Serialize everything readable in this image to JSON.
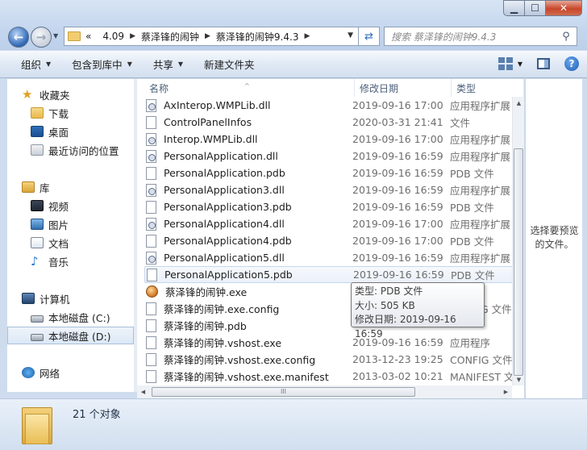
{
  "window": {
    "min_glyph": "▁",
    "max_glyph": "☐",
    "close_glyph": "✕"
  },
  "address": {
    "overflow": "«",
    "crumbs": [
      "4.09",
      "蔡泽锋的闹钟",
      "蔡泽锋的闹钟9.4.3"
    ],
    "separator": "▶",
    "dropdown": "▼"
  },
  "search": {
    "placeholder": "搜索 蔡泽锋的闹钟9.4.3"
  },
  "toolbar": {
    "organize": "组织",
    "include_in_library": "包含到库中",
    "share": "共享",
    "new_folder": "新建文件夹",
    "help": "?"
  },
  "nav": {
    "favorites": "收藏夹",
    "downloads": "下载",
    "desktop": "桌面",
    "recent": "最近访问的位置",
    "libraries": "库",
    "videos": "视频",
    "pictures": "图片",
    "documents": "文档",
    "music": "音乐",
    "computer": "计算机",
    "drive_c": "本地磁盘 (C:)",
    "drive_d": "本地磁盘 (D:)",
    "network": "网络"
  },
  "columns": {
    "name": "名称",
    "date": "修改日期",
    "type": "类型"
  },
  "files": [
    {
      "name": "AxInterop.WMPLib.dll",
      "date": "2019-09-16 17:00",
      "type": "应用程序扩展",
      "icon": "dll-icon"
    },
    {
      "name": "ControlPanelInfos",
      "date": "2020-03-31 21:41",
      "type": "文件",
      "icon": "file-icon"
    },
    {
      "name": "Interop.WMPLib.dll",
      "date": "2019-09-16 17:00",
      "type": "应用程序扩展",
      "icon": "dll-icon"
    },
    {
      "name": "PersonalApplication.dll",
      "date": "2019-09-16 16:59",
      "type": "应用程序扩展",
      "icon": "dll-icon"
    },
    {
      "name": "PersonalApplication.pdb",
      "date": "2019-09-16 16:59",
      "type": "PDB 文件",
      "icon": "file-icon"
    },
    {
      "name": "PersonalApplication3.dll",
      "date": "2019-09-16 16:59",
      "type": "应用程序扩展",
      "icon": "dll-icon"
    },
    {
      "name": "PersonalApplication3.pdb",
      "date": "2019-09-16 16:59",
      "type": "PDB 文件",
      "icon": "file-icon"
    },
    {
      "name": "PersonalApplication4.dll",
      "date": "2019-09-16 17:00",
      "type": "应用程序扩展",
      "icon": "dll-icon"
    },
    {
      "name": "PersonalApplication4.pdb",
      "date": "2019-09-16 17:00",
      "type": "PDB 文件",
      "icon": "file-icon"
    },
    {
      "name": "PersonalApplication5.dll",
      "date": "2019-09-16 16:59",
      "type": "应用程序扩展",
      "icon": "dll-icon"
    },
    {
      "name": "PersonalApplication5.pdb",
      "date": "2019-09-16 16:59",
      "type": "PDB 文件",
      "icon": "file-icon"
    },
    {
      "name": "蔡泽锋的闹钟.exe",
      "date": "",
      "type": "",
      "icon": "clock-exe-icon"
    },
    {
      "name": "蔡泽锋的闹钟.exe.config",
      "date": "",
      "type": "G 文件",
      "icon": "file-icon"
    },
    {
      "name": "蔡泽锋的闹钟.pdb",
      "date": "",
      "type": "",
      "icon": "file-icon"
    },
    {
      "name": "蔡泽锋的闹钟.vshost.exe",
      "date": "2019-09-16 16:59",
      "type": "应用程序",
      "icon": "vshost-icon"
    },
    {
      "name": "蔡泽锋的闹钟.vshost.exe.config",
      "date": "2013-12-23 19:25",
      "type": "CONFIG 文件",
      "icon": "file-icon"
    },
    {
      "name": "蔡泽锋的闹钟.vshost.exe.manifest",
      "date": "2013-03-02 10:21",
      "type": "MANIFEST 文件",
      "icon": "file-icon"
    }
  ],
  "tooltip": {
    "type_line": "类型: PDB 文件",
    "size_line": "大小: 505 KB",
    "date_line": "修改日期: 2019-09-16 16:59"
  },
  "preview": {
    "text": "选择要预览的文件。"
  },
  "details": {
    "count": "21 个对象"
  },
  "scroll": {
    "hthumb": "III"
  }
}
